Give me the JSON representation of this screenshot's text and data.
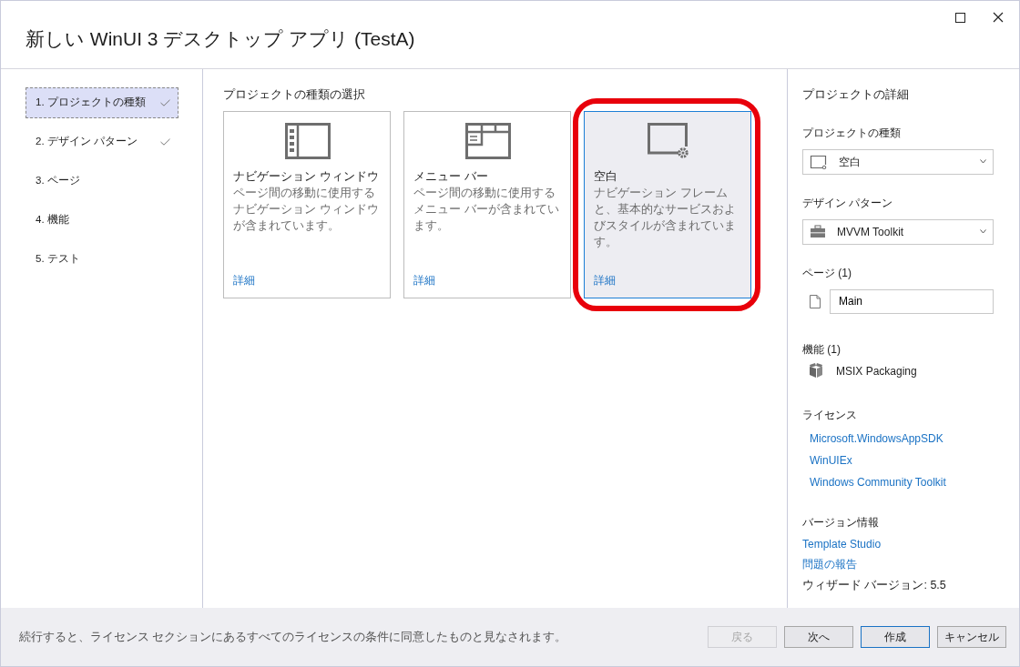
{
  "window": {
    "title": "新しい WinUI 3 デスクトップ アプリ (TestA)"
  },
  "steps": [
    {
      "label": "1. プロジェクトの種類",
      "selected": true,
      "completed": true
    },
    {
      "label": "2. デザイン パターン",
      "selected": false,
      "completed": true
    },
    {
      "label": "3. ページ",
      "selected": false,
      "completed": false
    },
    {
      "label": "4. 機能",
      "selected": false,
      "completed": false
    },
    {
      "label": "5. テスト",
      "selected": false,
      "completed": false
    }
  ],
  "content": {
    "heading": "プロジェクトの種類の選択",
    "cards": [
      {
        "kind": "navigation",
        "title": "ナビゲーション ウィンドウ",
        "description": "ページ間の移動に使用するナビゲーション ウィンドウが含まれています。",
        "link": "詳細",
        "selected": false,
        "highlighted": false
      },
      {
        "kind": "menubar",
        "title": "メニュー バー",
        "description": "ページ間の移動に使用するメニュー バーが含まれています。",
        "link": "詳細",
        "selected": false,
        "highlighted": false
      },
      {
        "kind": "blank",
        "title": "空白",
        "description": "ナビゲーション フレームと、基本的なサービスおよびスタイルが含まれています。",
        "link": "詳細",
        "selected": true,
        "highlighted": true
      }
    ]
  },
  "details": {
    "heading": "プロジェクトの詳細",
    "project_type": {
      "label": "プロジェクトの種類",
      "value": "空白"
    },
    "design_pattern": {
      "label": "デザイン パターン",
      "value": "MVVM Toolkit"
    },
    "pages": {
      "label": "ページ (1)",
      "items": [
        "Main"
      ]
    },
    "features": {
      "label": "機能 (1)",
      "items": [
        "MSIX Packaging"
      ]
    },
    "licenses": {
      "label": "ライセンス",
      "links": [
        "Microsoft.WindowsAppSDK",
        "WinUIEx",
        "Windows Community Toolkit"
      ]
    },
    "version": {
      "label": "バージョン情報",
      "links": [
        "Template Studio",
        "問題の報告"
      ],
      "text": "ウィザード バージョン: 5.5"
    }
  },
  "footer": {
    "notice": "続行すると、ライセンス セクションにあるすべてのライセンスの条件に同意したものと見なされます。",
    "buttons": [
      {
        "label": "戻る",
        "disabled": true,
        "default": false
      },
      {
        "label": "次へ",
        "disabled": false,
        "default": false
      },
      {
        "label": "作成",
        "disabled": false,
        "default": true
      },
      {
        "label": "キャンセル",
        "disabled": false,
        "default": false
      }
    ]
  }
}
